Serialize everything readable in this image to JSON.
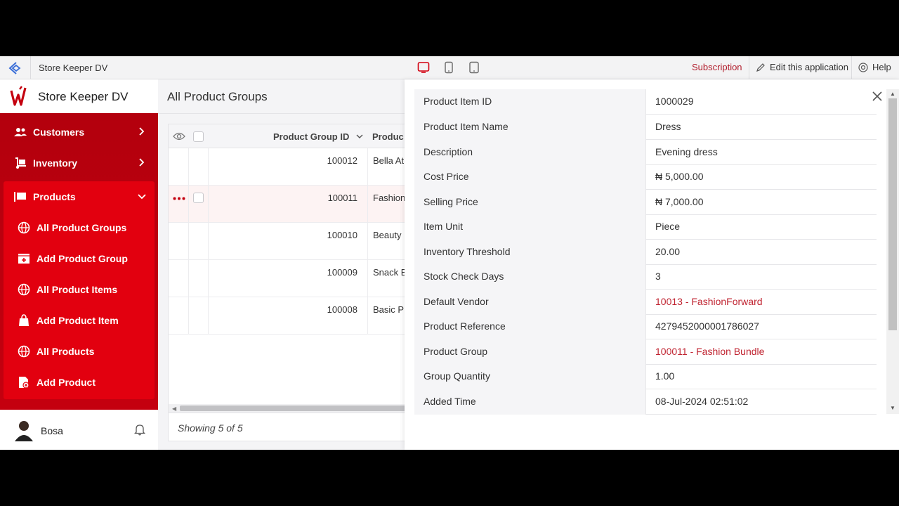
{
  "topbar": {
    "app_name": "Store Keeper DV",
    "subscription": "Subscription",
    "edit": "Edit this application",
    "help": "Help"
  },
  "sidebar": {
    "brand": "Store Keeper DV",
    "items": [
      {
        "label": "Customers"
      },
      {
        "label": "Inventory"
      },
      {
        "label": "Products"
      }
    ],
    "sub_items": [
      {
        "label": "All Product Groups"
      },
      {
        "label": "Add Product Group"
      },
      {
        "label": "All Product Items"
      },
      {
        "label": "Add Product Item"
      },
      {
        "label": "All Products"
      },
      {
        "label": "Add Product"
      }
    ],
    "user": "Bosa"
  },
  "main": {
    "title": "All Product Groups",
    "columns": [
      "Product Group ID",
      "Produc"
    ],
    "rows": [
      {
        "id": "100012",
        "name": "Bella At"
      },
      {
        "id": "100011",
        "name": "Fashion"
      },
      {
        "id": "100010",
        "name": "Beauty"
      },
      {
        "id": "100009",
        "name": "Snack B"
      },
      {
        "id": "100008",
        "name": "Basic P"
      }
    ],
    "footer": "Showing 5 of 5"
  },
  "detail": {
    "rows": [
      {
        "label": "Product Item ID",
        "value": "1000029"
      },
      {
        "label": "Product Item Name",
        "value": "Dress"
      },
      {
        "label": "Description",
        "value": "Evening dress"
      },
      {
        "label": "Cost Price",
        "value": "₦ 5,000.00"
      },
      {
        "label": "Selling Price",
        "value": "₦ 7,000.00"
      },
      {
        "label": "Item Unit",
        "value": "Piece"
      },
      {
        "label": "Inventory Threshold",
        "value": "20.00"
      },
      {
        "label": "Stock Check Days",
        "value": "3"
      },
      {
        "label": "Default Vendor",
        "value": "10013 - FashionForward"
      },
      {
        "label": "Product Reference",
        "value": "4279452000001786027"
      },
      {
        "label": "Product Group",
        "value": "100011 - Fashion Bundle"
      },
      {
        "label": "Group Quantity",
        "value": "1.00"
      },
      {
        "label": "Added Time",
        "value": "08-Jul-2024 02:51:02"
      }
    ]
  },
  "colors": {
    "brand_red": "#e2000f",
    "link_red": "#c02431"
  }
}
